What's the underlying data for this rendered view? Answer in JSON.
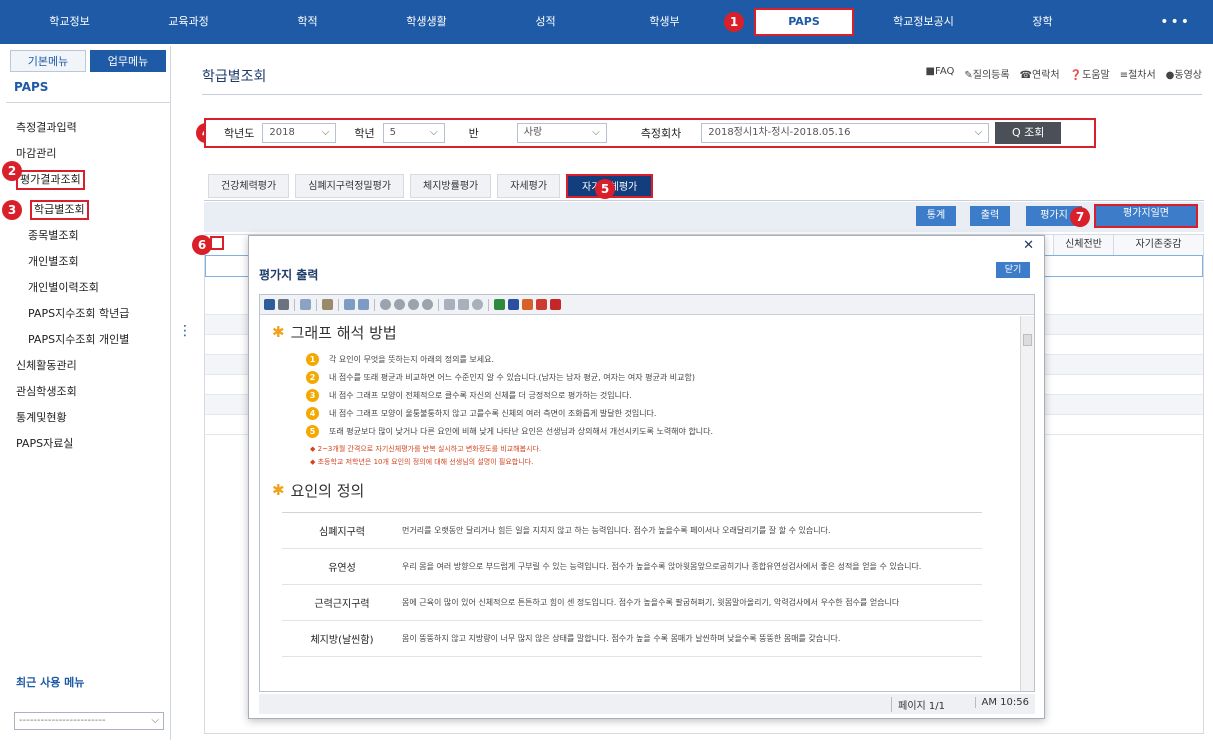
{
  "topnav": {
    "items": [
      "학교정보",
      "교육과정",
      "학적",
      "학생생활",
      "성적",
      "학생부",
      "PAPS",
      "학교정보공시",
      "장학"
    ],
    "active": "PAPS",
    "more": "•••"
  },
  "sidebar": {
    "tabs": [
      "기본메뉴",
      "업무메뉴"
    ],
    "title": "PAPS",
    "items": {
      "measure_input": "측정결과입력",
      "deadline": "마감관리",
      "result_view": "평가결과조회",
      "class_view": "학급별조회",
      "item_view": "종목별조회",
      "personal_view": "개인별조회",
      "personal_history": "개인별이력조회",
      "index_grade": "PAPS지수조회 학년급",
      "index_personal": "PAPS지수조회 개인별",
      "physical_activity": "신체활동관리",
      "concern_students": "관심학생조회",
      "stats": "통계및현황",
      "archive": "PAPS자료실"
    },
    "recent_title": "최근 사용 메뉴",
    "recent_value": "------------------------"
  },
  "main": {
    "page_title": "학급별조회",
    "util_links": [
      "■FAQ",
      "✎질의등록",
      "☎연락처",
      "❓도움말",
      "≡절차서",
      "●동영상"
    ]
  },
  "filter": {
    "year_label": "학년도",
    "year": "2018",
    "grade_label": "학년",
    "grade": "5",
    "class_label": "반",
    "class_value": "사랑",
    "round_label": "측정회차",
    "round_value": "2018정시1차-정시-2018.05.16",
    "search_label": "Q 조회"
  },
  "tabs": [
    "건강체력평가",
    "심폐지구력정밀평가",
    "체지방률평가",
    "자세평가",
    "자기신체평가"
  ],
  "active_tab": "자기신체평가",
  "actions": {
    "stats": "통계",
    "print": "출력",
    "form": "평가지",
    "form_print": "평가지일면"
  },
  "grid_headers": {
    "col_a": "신체전반",
    "col_b": "자기존중감"
  },
  "badges": [
    "1",
    "2",
    "3",
    "4",
    "5",
    "6",
    "7"
  ],
  "modal": {
    "title": "평가지 출력",
    "close_button": "닫기",
    "section1": "그래프 해석 방법",
    "guides": [
      "각 요인이 무엇을 뜻하는지 아래의 정의를 보세요.",
      "내 점수를 또래 평균과 비교하면 어느 수준인지 알 수 있습니다.(남자는 남자 평균, 여자는 여자 평균과 비교함)",
      "내 점수 그래프 모양이 전체적으로 클수록 자신의 신체를 더 긍정적으로 평가하는 것입니다.",
      "내 점수 그래프 모양이 울퉁불퉁하지 않고 고를수록 신체의 여러 측면이 조화롭게 발달한 것입니다.",
      "또래 평균보다 많이 낮거나 다른 요인에 비해 낮게 나타난 요인은 선생님과 상의해서 개선시키도록 노력해야 합니다."
    ],
    "notes": [
      "2~3개월 간격으로 자기신체평가를 반복 실시하고 변화정도를 비교해봅시다.",
      "초등학교 저학년은 10개 요인의 정의에 대해 선생님의 설명이 필요합니다."
    ],
    "section2": "요인의 정의",
    "definitions": [
      {
        "term": "심폐지구력",
        "desc": "먼거리를 오랫동안 달리거나 힘든 일을 지치지 않고 하는 능력입니다. 점수가 높을수록 페이서나 오래달리기를 잘 할 수 있습니다."
      },
      {
        "term": "유연성",
        "desc": "우리 몸을 여러 방향으로 부드럽게 구부릴 수 있는 능력입니다. 점수가 높을수록 앉아윗몸앞으로굽히기나 종합유연성검사에서 좋은 성적을 얻을 수 있습니다."
      },
      {
        "term": "근력근지구력",
        "desc": "몸에 근육이 많이 있어 신체적으로 튼튼하고 힘이 센 정도입니다. 점수가 높을수록 팔굽혀펴기, 윗몸말아올리기, 악력검사에서 우수한 점수를 얻습니다"
      },
      {
        "term": "체지방(날씬함)",
        "desc": "몸이 뚱뚱하지 않고 지방량이 너무 많지 않은 상태를 말합니다. 점수가 높을 수록 몸매가 날씬하며 낮을수록 뚱뚱한 몸매를 갖습니다."
      }
    ],
    "page_info": "페이지 1/1",
    "time": "AM 10:56"
  },
  "colors": {
    "nav": "#1e5aa6",
    "highlight": "#d9202a",
    "accent_button": "#3c7cc8"
  }
}
